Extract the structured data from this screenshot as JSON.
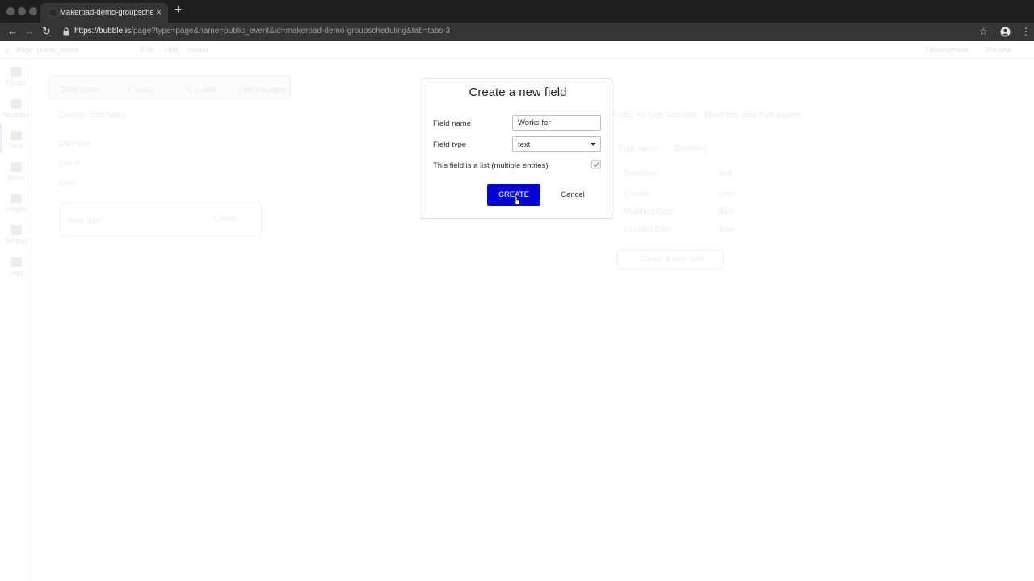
{
  "browser": {
    "tab_title": "Makerpad-demo-groupscheduling",
    "tab_close": "×",
    "new_tab": "+",
    "url_host": "https://bubble.is",
    "url_path": "/page?type=page&name=public_event&id=makerpad-demo-groupscheduling&tab=tabs-3"
  },
  "editor": {
    "page_selector": "Page: public_event",
    "menu_edit": "Edit",
    "menu_help": "Help",
    "menu_saved": "Saved",
    "env": "Development",
    "preview": "Preview",
    "left_nav": [
      "Design",
      "Workflow",
      "Data",
      "Styles",
      "Plugins",
      "Settings",
      "Logs"
    ],
    "data_tabs": [
      "Data types",
      "Privacy",
      "App data",
      "File manager"
    ],
    "custom_types_heading": "Custom data types",
    "types": [
      "Datetime",
      "Event",
      "User"
    ],
    "new_type_placeholder": "New type",
    "new_type_button": "Create",
    "fields_heading": "Fields for type Datetime",
    "fields_subheading": "Make this data type private",
    "type_name_label": "Type name",
    "type_name_value": "Datetime",
    "fields": [
      {
        "name": "Datetime",
        "type": "text"
      },
      {
        "name": "Creator",
        "type": "User"
      },
      {
        "name": "Modified Date",
        "type": "date"
      },
      {
        "name": "Created Date",
        "type": "date"
      }
    ],
    "create_field_button": "Create a new field"
  },
  "modal": {
    "title": "Create a new field",
    "field_name_label": "Field name",
    "field_name_value": "Works for",
    "field_type_label": "Field type",
    "field_type_value": "text",
    "list_label": "This field is a list (multiple entries)",
    "create_label": "CREATE",
    "cancel_label": "Cancel"
  },
  "colors": {
    "primary_button": "#0205d3"
  }
}
